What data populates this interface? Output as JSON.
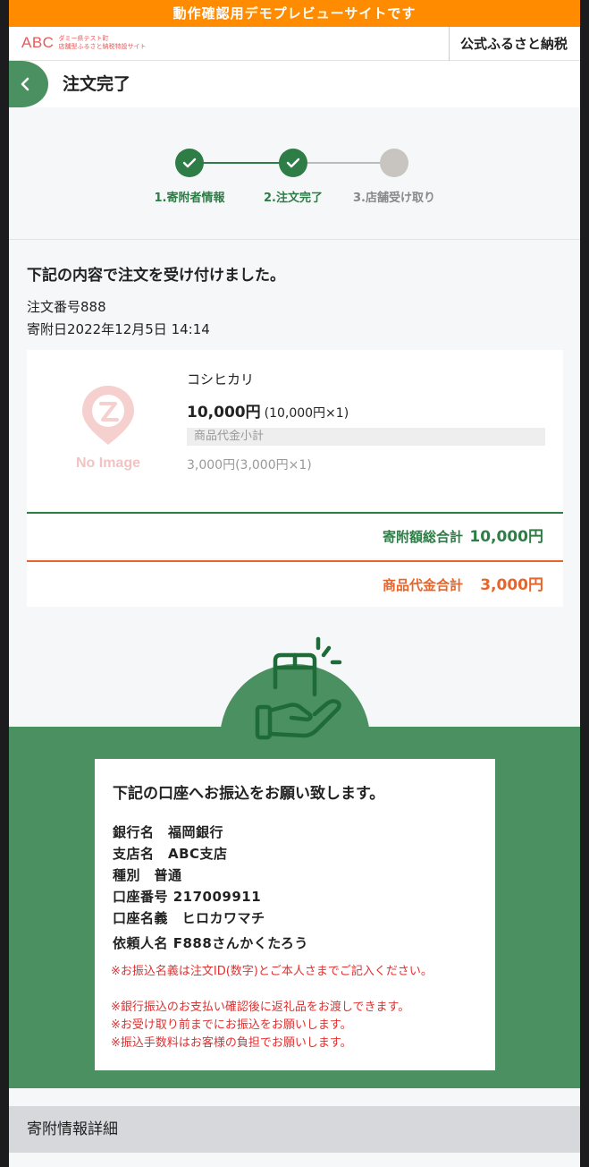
{
  "banner": "動作確認用デモプレビューサイトです",
  "header": {
    "logo_abc": "ABC",
    "logo_line1": "ダミー県テスト町",
    "logo_line2": "店舗型ふるさと納税特設サイト",
    "site_title": "公式ふるさと納税"
  },
  "page_title": "注文完了",
  "steps": [
    {
      "label": "1.寄附者情報",
      "state": "done"
    },
    {
      "label": "2.注文完了",
      "state": "done"
    },
    {
      "label": "3.店舗受け取り",
      "state": "pending"
    }
  ],
  "confirmation": {
    "message": "下記の内容で注文を受け付けました。",
    "order_number": "注文番号888",
    "donation_date": "寄附日2022年12月5日 14:14"
  },
  "product": {
    "image_placeholder": "No Image",
    "name": "コシヒカリ",
    "price": "10,000円",
    "price_detail": "(10,000円×1)",
    "subtotal_label": "商品代金小計",
    "goods_price": "3,000円(3,000円×1)"
  },
  "totals": {
    "donation_label": "寄附額総合計",
    "donation_value": "10,000円",
    "goods_label": "商品代金合計",
    "goods_value": "3,000円"
  },
  "bank": {
    "title": "下記の口座へお振込をお願い致します。",
    "rows": [
      "銀行名　福岡銀行",
      "支店名　ABC支店",
      "種別　普通",
      "口座番号 217009911",
      "口座名義　ヒロカワマチ",
      "依頼人名 F888さんかくたろう"
    ],
    "notes": [
      "※お振込名義は注文ID(数字)とご本人さまでご記入ください。",
      "※銀行振込のお支払い確認後に返礼品をお渡しできます。",
      "※お受け取り前までにお振込をお願いします。",
      "※振込手数料はお客様の負担でお願いします。"
    ]
  },
  "detail_section_title": "寄附情報詳細",
  "colors": {
    "banner": "#ff8c00",
    "brand_green": "#4a9060",
    "step_green": "#2e7d46",
    "orange": "#e8652a",
    "note_red": "#e03030"
  }
}
